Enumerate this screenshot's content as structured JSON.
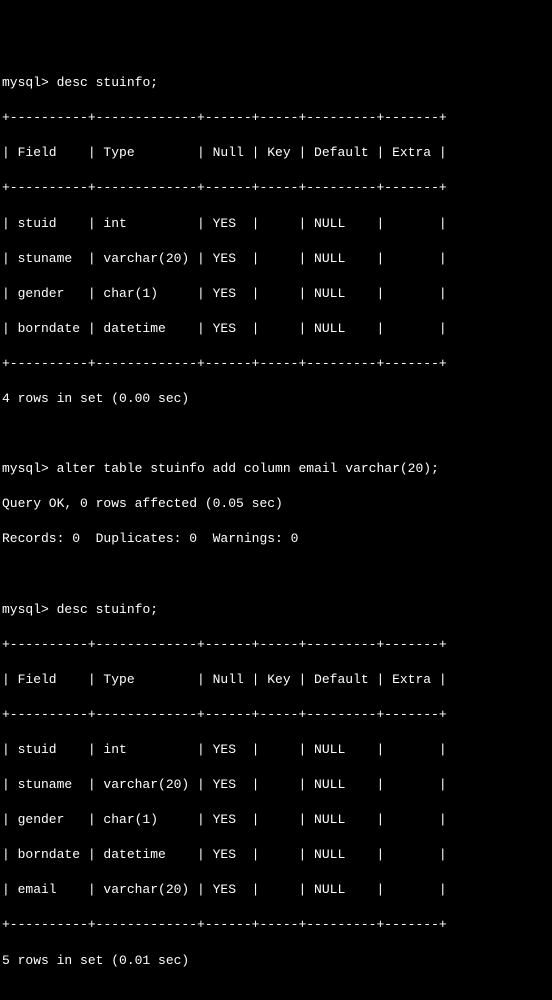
{
  "session": {
    "prompt": "mysql>",
    "commands": {
      "desc1": "desc stuinfo;",
      "alter": "alter table stuinfo add column email varchar(20);",
      "desc2": "desc stuinfo;"
    },
    "alter_result": {
      "line1": "Query OK, 0 rows affected (0.05 sec)",
      "line2": "Records: 0  Duplicates: 0  Warnings: 0"
    },
    "table1": {
      "border": "+----------+-------------+------+-----+---------+-------+",
      "header": "| Field    | Type        | Null | Key | Default | Extra |",
      "rows": {
        "r0": "| stuid    | int         | YES  |     | NULL    |       |",
        "r1": "| stuname  | varchar(20) | YES  |     | NULL    |       |",
        "r2": "| gender   | char(1)     | YES  |     | NULL    |       |",
        "r3": "| borndate | datetime    | YES  |     | NULL    |       |"
      },
      "footer": "4 rows in set (0.00 sec)"
    },
    "table2": {
      "border": "+----------+-------------+------+-----+---------+-------+",
      "header": "| Field    | Type        | Null | Key | Default | Extra |",
      "rows": {
        "r0": "| stuid    | int         | YES  |     | NULL    |       |",
        "r1": "| stuname  | varchar(20) | YES  |     | NULL    |       |",
        "r2": "| gender   | char(1)     | YES  |     | NULL    |       |",
        "r3": "| borndate | datetime    | YES  |     | NULL    |       |",
        "r4": "| email    | varchar(20) | YES  |     | NULL    |       |"
      },
      "footer": "5 rows in set (0.01 sec)"
    }
  }
}
